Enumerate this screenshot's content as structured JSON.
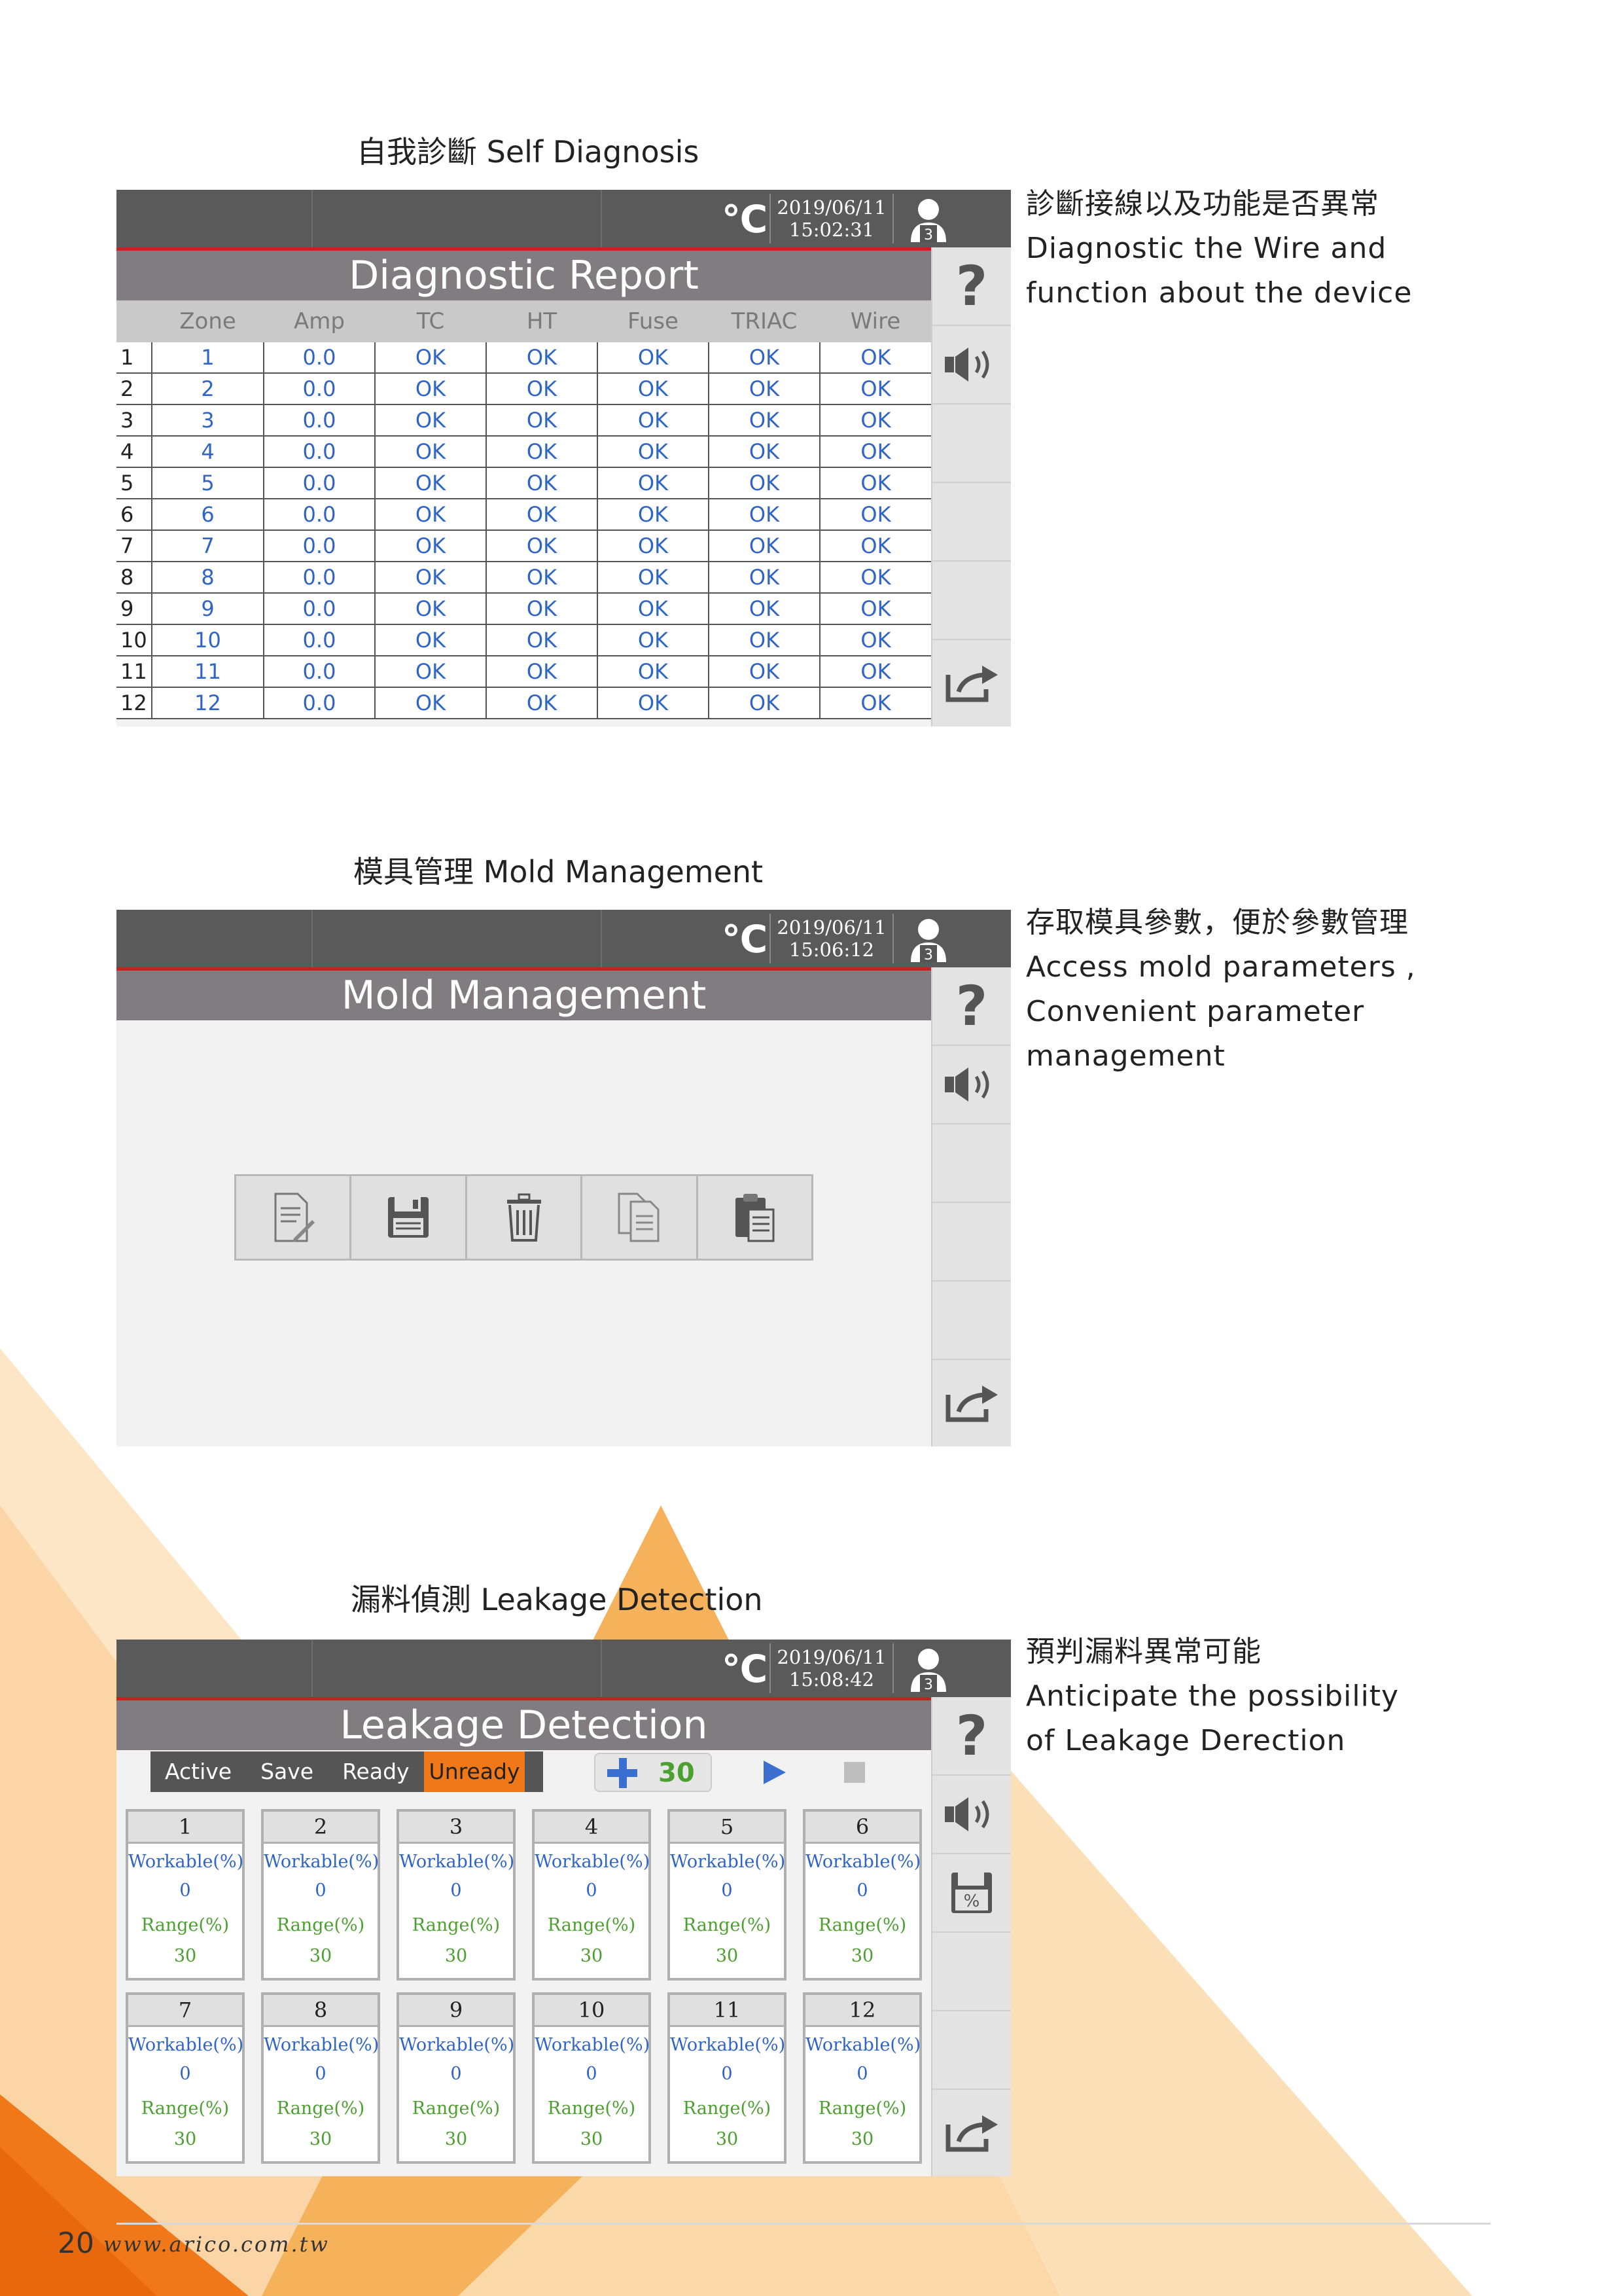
{
  "page": {
    "number": "20",
    "url": "www.arico.com.tw"
  },
  "colors": {
    "accent_orange": "#f07818",
    "title_red": "#c82020",
    "ok_blue": "#2f64c8",
    "range_green": "#4ca030"
  },
  "sections": {
    "self_diagnosis": {
      "heading": "自我診斷 Self Diagnosis",
      "desc": [
        "診斷接線以及功能是否異常",
        "Diagnostic the Wire and",
        "function about the device"
      ],
      "screen": {
        "date": "2019/06/11",
        "time": "15:02:31",
        "user_level": "3",
        "title": "Diagnostic Report",
        "columns": [
          "Zone",
          "Amp",
          "TC",
          "HT",
          "Fuse",
          "TRIAC",
          "Wire"
        ],
        "rows": [
          [
            "1",
            "1",
            "0.0",
            "OK",
            "OK",
            "OK",
            "OK",
            "OK"
          ],
          [
            "2",
            "2",
            "0.0",
            "OK",
            "OK",
            "OK",
            "OK",
            "OK"
          ],
          [
            "3",
            "3",
            "0.0",
            "OK",
            "OK",
            "OK",
            "OK",
            "OK"
          ],
          [
            "4",
            "4",
            "0.0",
            "OK",
            "OK",
            "OK",
            "OK",
            "OK"
          ],
          [
            "5",
            "5",
            "0.0",
            "OK",
            "OK",
            "OK",
            "OK",
            "OK"
          ],
          [
            "6",
            "6",
            "0.0",
            "OK",
            "OK",
            "OK",
            "OK",
            "OK"
          ],
          [
            "7",
            "7",
            "0.0",
            "OK",
            "OK",
            "OK",
            "OK",
            "OK"
          ],
          [
            "8",
            "8",
            "0.0",
            "OK",
            "OK",
            "OK",
            "OK",
            "OK"
          ],
          [
            "9",
            "9",
            "0.0",
            "OK",
            "OK",
            "OK",
            "OK",
            "OK"
          ],
          [
            "10",
            "10",
            "0.0",
            "OK",
            "OK",
            "OK",
            "OK",
            "OK"
          ],
          [
            "11",
            "11",
            "0.0",
            "OK",
            "OK",
            "OK",
            "OK",
            "OK"
          ],
          [
            "12",
            "12",
            "0.0",
            "OK",
            "OK",
            "OK",
            "OK",
            "OK"
          ]
        ]
      }
    },
    "mold_management": {
      "heading": "模具管理 Mold Management",
      "desc": [
        "存取模具參數，便於參數管理",
        "Access mold parameters ,",
        "Convenient parameter",
        "management"
      ],
      "screen": {
        "date": "2019/06/11",
        "time": "15:06:12",
        "user_level": "3",
        "title": "Mold Management",
        "tools": [
          "edit-document-icon",
          "save-disk-icon",
          "trash-icon",
          "copy-icon",
          "paste-icon"
        ]
      }
    },
    "leakage_detection": {
      "heading": "漏料偵測 Leakage Detection",
      "desc": [
        "預判漏料異常可能",
        "Anticipate the possibility",
        "of Leakage Derection"
      ],
      "screen": {
        "date": "2019/06/11",
        "time": "15:08:42",
        "user_level": "3",
        "title": "Leakage Detection",
        "status": {
          "active": "Active",
          "save": "Save",
          "ready": "Ready",
          "unready": "Unready"
        },
        "step_value": "30",
        "workable_label": "Workable(%)",
        "range_label": "Range(%)",
        "zones": [
          {
            "zone": "1",
            "workable": "0",
            "range": "30"
          },
          {
            "zone": "2",
            "workable": "0",
            "range": "30"
          },
          {
            "zone": "3",
            "workable": "0",
            "range": "30"
          },
          {
            "zone": "4",
            "workable": "0",
            "range": "30"
          },
          {
            "zone": "5",
            "workable": "0",
            "range": "30"
          },
          {
            "zone": "6",
            "workable": "0",
            "range": "30"
          },
          {
            "zone": "7",
            "workable": "0",
            "range": "30"
          },
          {
            "zone": "8",
            "workable": "0",
            "range": "30"
          },
          {
            "zone": "9",
            "workable": "0",
            "range": "30"
          },
          {
            "zone": "10",
            "workable": "0",
            "range": "30"
          },
          {
            "zone": "11",
            "workable": "0",
            "range": "30"
          },
          {
            "zone": "12",
            "workable": "0",
            "range": "30"
          }
        ]
      }
    }
  }
}
